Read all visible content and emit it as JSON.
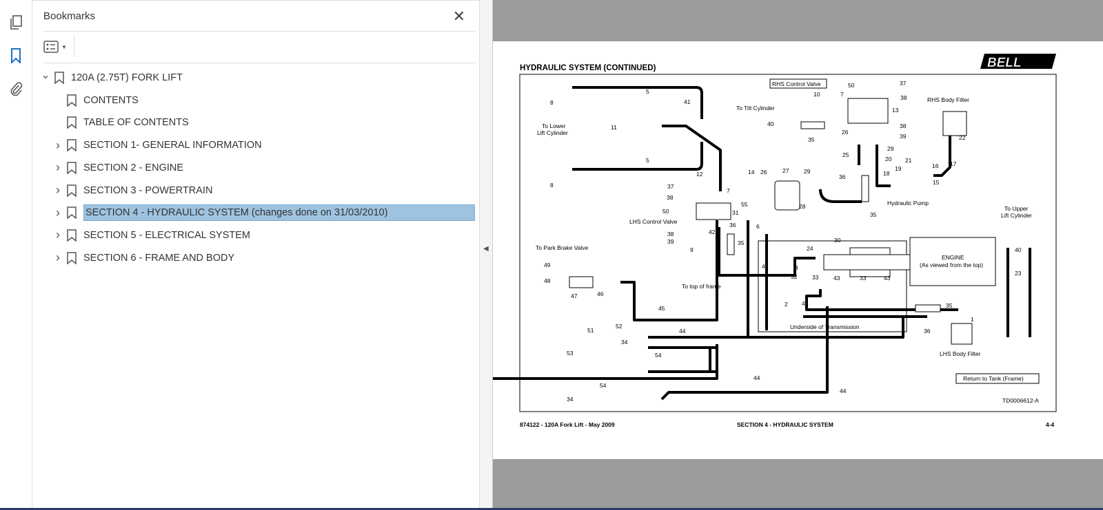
{
  "sidebar": {
    "panel_title": "Bookmarks",
    "close_label": "✕",
    "rail_icons": [
      "pages-icon",
      "bookmark-icon",
      "attachment-icon"
    ],
    "bookmarks": [
      {
        "label": "120A (2.75T) FORK LIFT",
        "level": 0,
        "expanded": true
      },
      {
        "label": "CONTENTS",
        "level": 1
      },
      {
        "label": "TABLE OF CONTENTS",
        "level": 1
      },
      {
        "label": "SECTION 1- GENERAL INFORMATION",
        "level": 1,
        "expandable": true
      },
      {
        "label": "SECTION 2 - ENGINE",
        "level": 1,
        "expandable": true
      },
      {
        "label": "SECTION 3 - POWERTRAIN",
        "level": 1,
        "expandable": true
      },
      {
        "label": "SECTION 4 - HYDRAULIC SYSTEM (changes done on 31/03/2010)",
        "level": 1,
        "expandable": true,
        "selected": true
      },
      {
        "label": "SECTION 5 - ELECTRICAL SYSTEM",
        "level": 1,
        "expandable": true
      },
      {
        "label": "SECTION 6 - FRAME AND BODY",
        "level": 1,
        "expandable": true
      }
    ],
    "selected_color": "#9ec3e0"
  },
  "document": {
    "heading": "HYDRAULIC SYSTEM (CONTINUED)",
    "logo": "BELL",
    "figure_id": "TD0006612-A",
    "footer_left": "874122 - 120A Fork Lift - May 2009",
    "footer_center": "SECTION 4 - HYDRAULIC SYSTEM",
    "footer_right": "4-4",
    "labels": {
      "rhs_valve": "RHS Control Valve",
      "lhs_valve": "LHS Control Valve",
      "tilt": "To Tilt Cylinder",
      "lower_lift": "To Lower",
      "lower_lift2": "Lift Cylinder",
      "rhs_filter": "RHS Body Filter",
      "pump": "Hydraulic Pump",
      "upper_lift": "To Upper",
      "upper_lift2": "Lift Cylinder",
      "park": "To Park Brake Valve",
      "frame_top": "To top of frame",
      "engine": "ENGINE",
      "engine2": "(As viewed from the top)",
      "transmission": "Underside of Transmission",
      "lhs_filter": "LHS Body Filter",
      "tank": "Return to Tank (Frame)"
    },
    "callouts": [
      "5",
      "8",
      "41",
      "11",
      "5",
      "8",
      "50",
      "37",
      "10",
      "7",
      "38",
      "13",
      "40",
      "35",
      "26",
      "38",
      "39",
      "29",
      "25",
      "20",
      "36",
      "18",
      "19",
      "21",
      "16",
      "15",
      "17",
      "22",
      "14",
      "26",
      "27",
      "29",
      "28",
      "35",
      "12",
      "37",
      "38",
      "7",
      "50",
      "31",
      "55",
      "36",
      "6",
      "35",
      "38",
      "39",
      "42",
      "9",
      "24",
      "30",
      "4",
      "3",
      "32",
      "33",
      "43",
      "33",
      "43",
      "2",
      "44",
      "35",
      "1",
      "36",
      "40",
      "23",
      "49",
      "48",
      "47",
      "46",
      "45",
      "52",
      "51",
      "34",
      "53",
      "54",
      "44",
      "54",
      "34",
      "44",
      "44"
    ]
  }
}
